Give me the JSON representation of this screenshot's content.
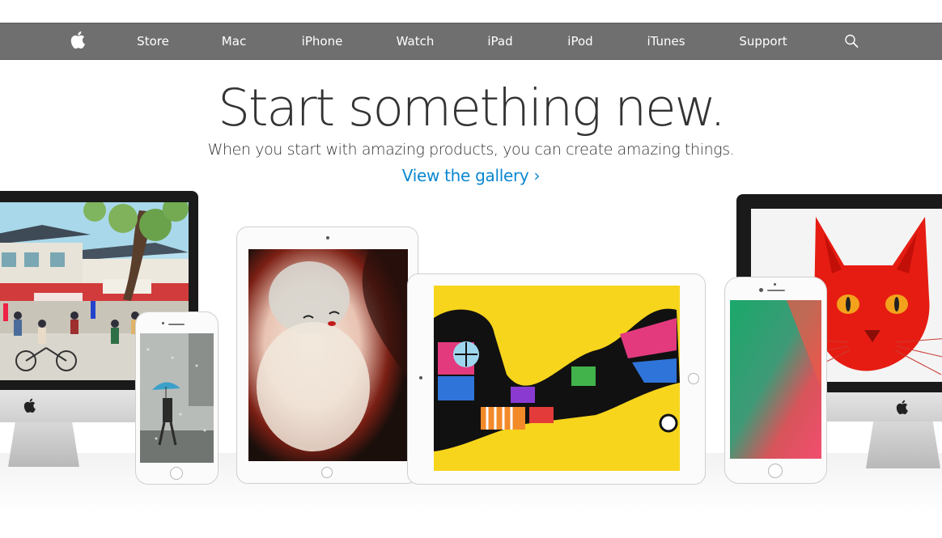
{
  "nav": {
    "apple_icon": "apple-logo-icon",
    "items": [
      "Store",
      "Mac",
      "iPhone",
      "Watch",
      "iPad",
      "iPod",
      "iTunes",
      "Support"
    ],
    "search_icon": "search-icon",
    "colors": {
      "bar": "#6f6f6f",
      "text": "#ffffff"
    }
  },
  "hero": {
    "title": "Start something new.",
    "subtitle": "When you start with amazing products, you can create amazing things.",
    "link": "View the gallery ›",
    "link_color": "#0a87d0"
  },
  "devices": [
    {
      "name": "imac-left",
      "artwork": "street-scene-illustration"
    },
    {
      "name": "iphone-left",
      "artwork": "person-with-umbrella-in-rain-photo"
    },
    {
      "name": "ipad-left",
      "artwork": "pale-face-painting"
    },
    {
      "name": "ipad-mid",
      "artwork": "colorful-cat-doodle-on-yellow"
    },
    {
      "name": "iphone-right",
      "artwork": "green-red-gradient-wallpaper"
    },
    {
      "name": "imac-right",
      "artwork": "red-cat-portrait"
    }
  ]
}
